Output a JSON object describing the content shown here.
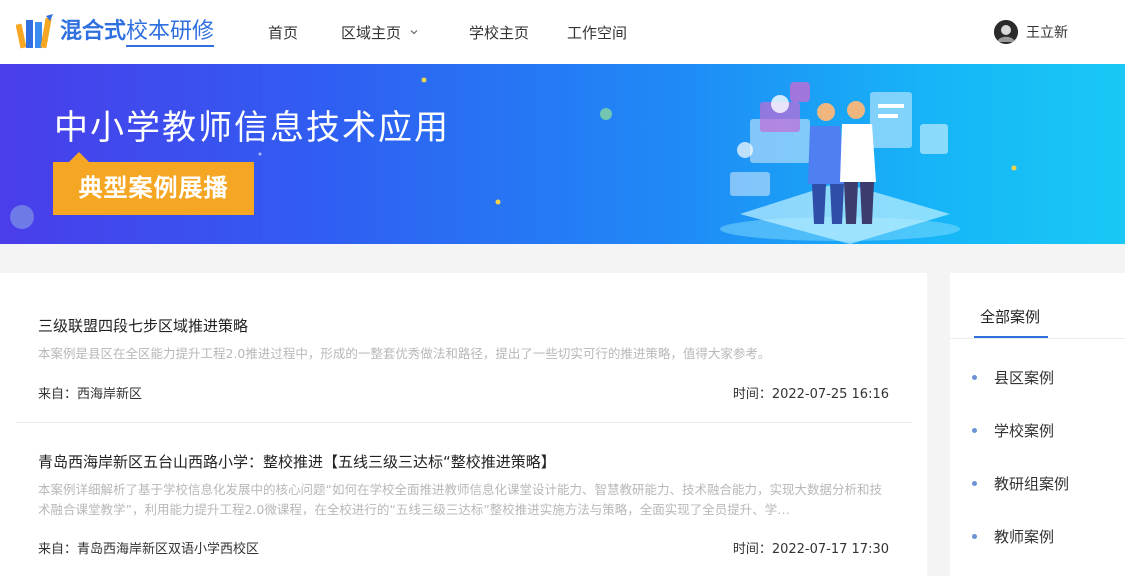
{
  "header": {
    "logo": {
      "strong": "混合式",
      "plain": "校本研修"
    },
    "nav": [
      {
        "label": "首页"
      },
      {
        "label": "区域主页"
      },
      {
        "label": "学校主页"
      },
      {
        "label": "工作空间"
      }
    ],
    "user_name": "王立新"
  },
  "banner": {
    "title": "中小学教师信息技术应用",
    "tag": "典型案例展播"
  },
  "cases": [
    {
      "title": "三级联盟四段七步区域推进策略",
      "desc": "本案例是县区在全区能力提升工程2.0推进过程中，形成的一整套优秀做法和路径，提出了一些切实可行的推进策略，值得大家参考。",
      "from": "来自：西海岸新区",
      "time": "时间：2022-07-25 16:16"
    },
    {
      "title": "青岛西海岸新区五台山西路小学：整校推进【五线三级三达标“整校推进策略】",
      "desc": "本案例详细解析了基于学校信息化发展中的核心问题“如何在学校全面推进教师信息化课堂设计能力、智慧教研能力、技术融合能力，实现大数据分析和技术融合课堂教学”，利用能力提升工程2.0微课程，在全校进行的“五线三级三达标”整校推进实施方法与策略，全面实现了全员提升、学…",
      "from": "来自：青岛西海岸新区双语小学西校区",
      "time": "时间：2022-07-17 17:30"
    }
  ],
  "sidebar": {
    "head": "全部案例",
    "items": [
      {
        "label": "县区案例"
      },
      {
        "label": "学校案例"
      },
      {
        "label": "教研组案例"
      },
      {
        "label": "教师案例"
      }
    ]
  },
  "colors": {
    "accent": "#2f6fe0",
    "tag": "#f5a623"
  }
}
